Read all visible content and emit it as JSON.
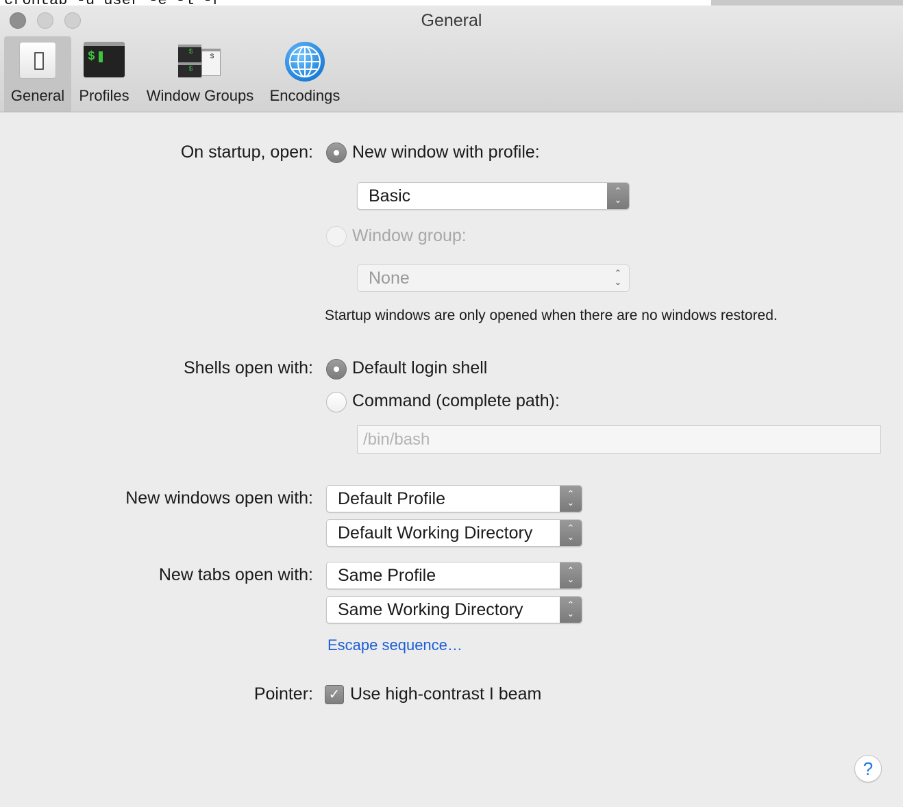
{
  "background_terminal": {
    "text": "crontab -u user -e -l -r"
  },
  "window": {
    "title": "General"
  },
  "toolbar": {
    "tabs": [
      {
        "label": "General",
        "icon": "general-switch-icon",
        "selected": true
      },
      {
        "label": "Profiles",
        "icon": "terminal-icon",
        "selected": false
      },
      {
        "label": "Window Groups",
        "icon": "window-groups-icon",
        "selected": false
      },
      {
        "label": "Encodings",
        "icon": "globe-icon",
        "selected": false
      }
    ],
    "icon_glyphs": {
      "profiles": "$",
      "wg_a": "$",
      "wg_b": "$",
      "wg_c": "$"
    }
  },
  "startup": {
    "label": "On startup, open:",
    "option_profile": "New window with profile:",
    "profile_value": "Basic",
    "option_group": "Window group:",
    "group_value": "None",
    "note": "Startup windows are only opened when there are no windows restored."
  },
  "shells": {
    "label": "Shells open with:",
    "option_default": "Default login shell",
    "option_command": "Command (complete path):",
    "command_placeholder": "/bin/bash"
  },
  "new_windows": {
    "label": "New windows open with:",
    "profile_value": "Default Profile",
    "directory_value": "Default Working Directory"
  },
  "new_tabs": {
    "label": "New tabs open with:",
    "profile_value": "Same Profile",
    "directory_value": "Same Working Directory"
  },
  "escape_link": "Escape sequence…",
  "pointer": {
    "label": "Pointer:",
    "checkbox_label": "Use high-contrast I beam",
    "checked": true
  },
  "help": {
    "glyph": "?"
  },
  "colors": {
    "link": "#1a5ed8",
    "accent_gray": "#8a8a8a",
    "window_bg": "#ececec"
  }
}
